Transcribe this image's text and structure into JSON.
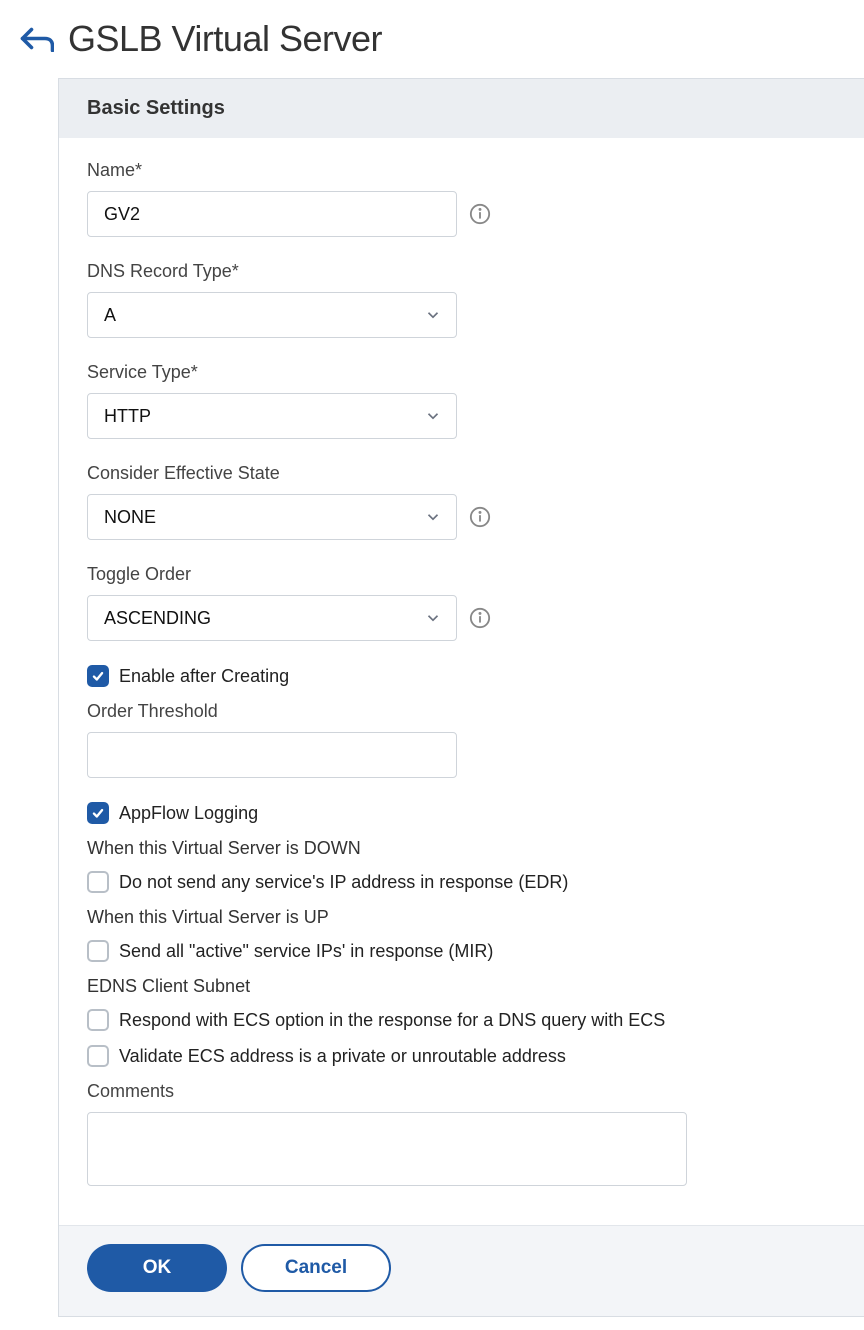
{
  "header": {
    "title": "GSLB Virtual Server"
  },
  "panel": {
    "header": "Basic Settings",
    "fields": {
      "name_label": "Name*",
      "name_value": "GV2",
      "dns_record_type_label": "DNS Record Type*",
      "dns_record_type_value": "A",
      "service_type_label": "Service Type*",
      "service_type_value": "HTTP",
      "consider_effective_state_label": "Consider Effective State",
      "consider_effective_state_value": "NONE",
      "toggle_order_label": "Toggle Order",
      "toggle_order_value": "ASCENDING",
      "enable_after_creating_label": "Enable after Creating",
      "order_threshold_label": "Order Threshold",
      "order_threshold_value": "",
      "appflow_logging_label": "AppFlow Logging",
      "down_section": "When this Virtual Server is DOWN",
      "edr_label": "Do not send any service's IP address in response (EDR)",
      "up_section": "When this Virtual Server is UP",
      "mir_label": "Send all \"active\" service IPs' in response (MIR)",
      "edns_section": "EDNS Client Subnet",
      "ecs_respond_label": "Respond with ECS option in the response for a DNS query with ECS",
      "ecs_validate_label": "Validate ECS address is a private or unroutable address",
      "comments_label": "Comments",
      "comments_value": ""
    },
    "buttons": {
      "ok_label": "OK",
      "cancel_label": "Cancel"
    }
  }
}
